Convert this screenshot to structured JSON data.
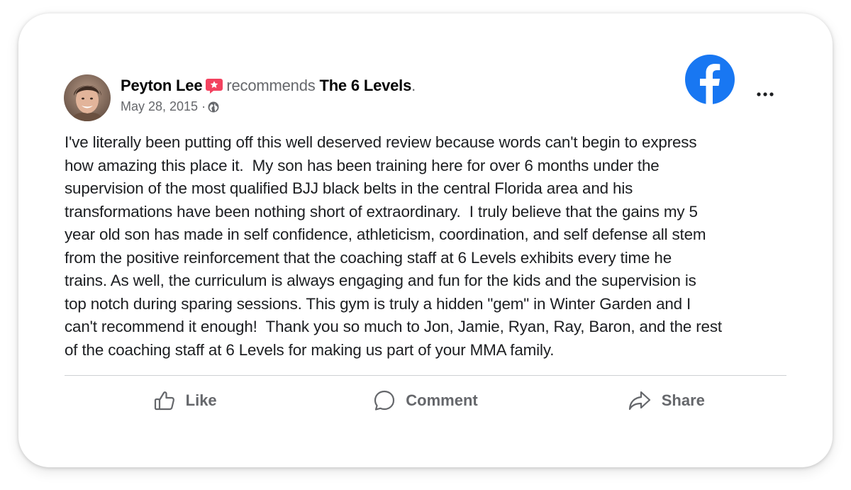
{
  "post": {
    "author_name": "Peyton Lee",
    "verb": "recommends",
    "page_name": "The 6 Levels",
    "page_suffix": ".",
    "date": "May 28, 2015 ·",
    "privacy_icon": "globe-icon",
    "recommend_badge_icon": "star-badge-icon",
    "text": "I've literally been putting off this well deserved review because words can't begin to express\nhow amazing this place it.  My son has been training here for over 6 months under the\nsupervision of the most qualified BJJ black belts in the central Florida area and his\ntransformations have been nothing short of extraordinary.  I truly believe that the gains my 5\nyear old son has made in self confidence, athleticism, coordination, and self defense all stem\nfrom the positive reinforcement that the coaching staff at 6 Levels exhibits every time he\ntrains. As well, the curriculum is always engaging and fun for the kids and the supervision is\ntop notch during sparing sessions. This gym is truly a hidden \"gem\" in Winter Garden and I\ncan't recommend it enough!  Thank you so much to Jon, Jamie, Ryan, Ray, Baron, and the rest\nof the coaching staff at 6 Levels for making us part of your MMA family."
  },
  "header": {
    "logo_icon": "facebook-logo-icon",
    "more_icon": "more-options-icon"
  },
  "actions": {
    "like_label": "Like",
    "comment_label": "Comment",
    "share_label": "Share"
  },
  "colors": {
    "facebook_blue": "#1877f2",
    "badge_pink": "#f3425f",
    "secondary_text": "#65676b",
    "primary_text": "#050505"
  }
}
